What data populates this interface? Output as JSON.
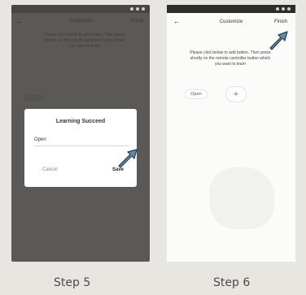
{
  "step5": {
    "label": "Step 5",
    "screen": {
      "title": "Customize",
      "finish": "Finish",
      "instructions": "Please click below to add button. Then press shortly on the remote controller button which you want to learn"
    },
    "dialog": {
      "title": "Learning Succeed",
      "field_value": "Open",
      "cancel_label": "Cancel",
      "save_label": "Save"
    }
  },
  "step6": {
    "label": "Step 6",
    "screen": {
      "back_icon": "←",
      "title": "Customize",
      "finish": "Finish",
      "instructions": "Please click below to add button. Then press shortly on the remote controller button which you want to learn",
      "open_button": "Open",
      "add_button": "+"
    }
  },
  "colors": {
    "arrow": "#5a8db5",
    "arrow_outline": "#2f3a44"
  }
}
